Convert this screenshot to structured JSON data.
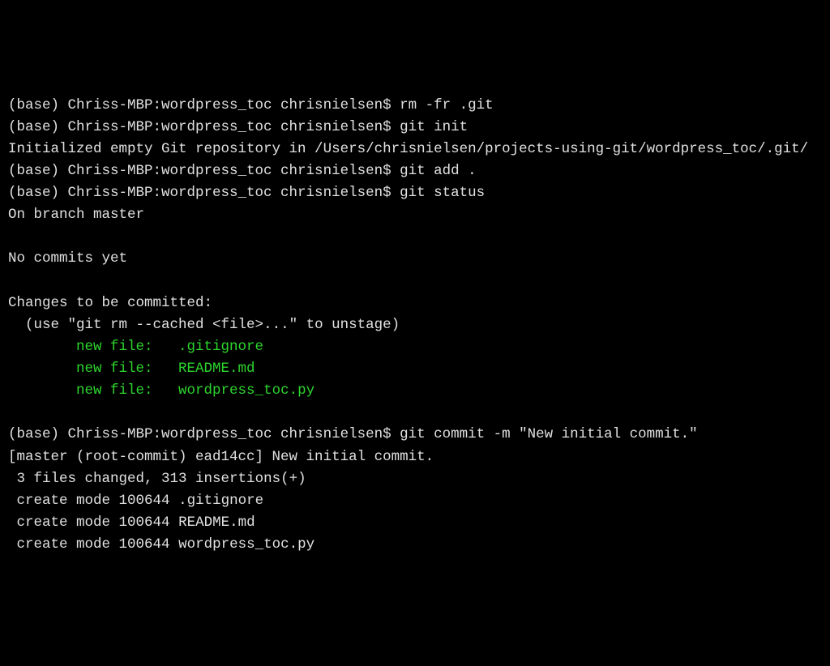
{
  "prompt_prefix": "(base) Chriss-MBP:wordpress_toc chrisnielsen$ ",
  "cmd1": "rm -fr .git",
  "cmd2": "git init",
  "init_output": "Initialized empty Git repository in /Users/chrisnielsen/projects-using-git/wordpress_toc/.git/",
  "cmd3": "git add .",
  "cmd4": "git status",
  "status_branch": "On branch master",
  "status_nocommits": "No commits yet",
  "status_changes_header": "Changes to be committed:",
  "status_unstage_hint": "  (use \"git rm --cached <file>...\" to unstage)",
  "new_file_label": "new file:   ",
  "staged_file1": ".gitignore",
  "staged_file2": "README.md",
  "staged_file3": "wordpress_toc.py",
  "indent8": "        ",
  "cmd5": "git commit -m \"New initial commit.\"",
  "commit_line1": "[master (root-commit) ead14cc] New initial commit.",
  "commit_stats": " 3 files changed, 313 insertions(+)",
  "create_mode_prefix": " create mode 100644 ",
  "create_file1": ".gitignore",
  "create_file2": "README.md",
  "create_file3": "wordpress_toc.py"
}
